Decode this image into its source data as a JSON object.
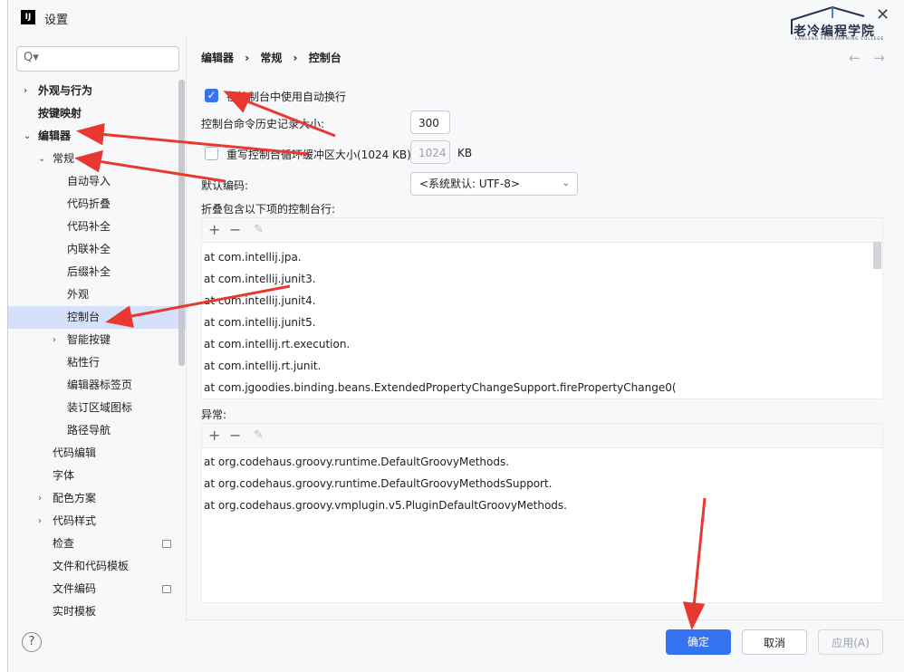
{
  "window": {
    "title": "设置",
    "app_icon": "IJ",
    "close_glyph": "✕"
  },
  "logo": {
    "text": "老冷编程学院",
    "subtext": "LAOLENG PROGRAMMING COLLEGE"
  },
  "search": {
    "placeholder": "Q▾"
  },
  "sidebar": {
    "items": [
      {
        "label": "外观与行为",
        "chevron": "›",
        "bold": true
      },
      {
        "label": "按键映射",
        "bold": true
      },
      {
        "label": "编辑器",
        "chevron": "⌄",
        "bold": true
      },
      {
        "label": "常规",
        "chevron": "⌄"
      },
      {
        "label": "自动导入"
      },
      {
        "label": "代码折叠"
      },
      {
        "label": "代码补全"
      },
      {
        "label": "内联补全"
      },
      {
        "label": "后缀补全"
      },
      {
        "label": "外观"
      },
      {
        "label": "控制台",
        "selected": true
      },
      {
        "label": "智能按键",
        "chevron": "›"
      },
      {
        "label": "粘性行"
      },
      {
        "label": "编辑器标签页"
      },
      {
        "label": "装订区域图标"
      },
      {
        "label": "路径导航"
      },
      {
        "label": "代码编辑"
      },
      {
        "label": "字体"
      },
      {
        "label": "配色方案",
        "chevron": "›"
      },
      {
        "label": "代码样式",
        "chevron": "›"
      },
      {
        "label": "检查",
        "badge": true
      },
      {
        "label": "文件和代码模板"
      },
      {
        "label": "文件编码",
        "badge": true
      },
      {
        "label": "实时模板"
      }
    ]
  },
  "breadcrumb": {
    "p1": "编辑器",
    "sep": "›",
    "p2": "常规",
    "p3": "控制台"
  },
  "nav": {
    "back": "←",
    "forward": "→"
  },
  "console": {
    "soft_wrap_label": "在控制台中使用自动换行",
    "history_label": "控制台命令历史记录大小:",
    "history_value": "300",
    "cyclic_label": "重写控制台循环缓冲区大小(1024 KB)",
    "cyclic_value": "1024",
    "cyclic_unit": "KB",
    "encoding_label": "默认编码:",
    "encoding_value": "<系统默认: UTF-8>",
    "fold_label": "折叠包含以下项的控制台行:",
    "fold_lines": [
      "at com.intellij.jpa.",
      "at com.intellij.junit3.",
      "at com.intellij.junit4.",
      "at com.intellij.junit5.",
      "at com.intellij.rt.execution.",
      "at com.intellij.rt.junit.",
      "at com.jgoodies.binding.beans.ExtendedPropertyChangeSupport.firePropertyChange0("
    ],
    "exceptions_label": "异常:",
    "exception_lines": [
      "at org.codehaus.groovy.runtime.DefaultGroovyMethods.",
      "at org.codehaus.groovy.runtime.DefaultGroovyMethodsSupport.",
      "at org.codehaus.groovy.vmplugin.v5.PluginDefaultGroovyMethods."
    ]
  },
  "toolbar": {
    "add": "+",
    "remove": "−",
    "edit": "✎"
  },
  "footer": {
    "help": "?",
    "ok": "确定",
    "cancel": "取消",
    "apply": "应用(A)"
  },
  "annotation_color": "#e8382f"
}
